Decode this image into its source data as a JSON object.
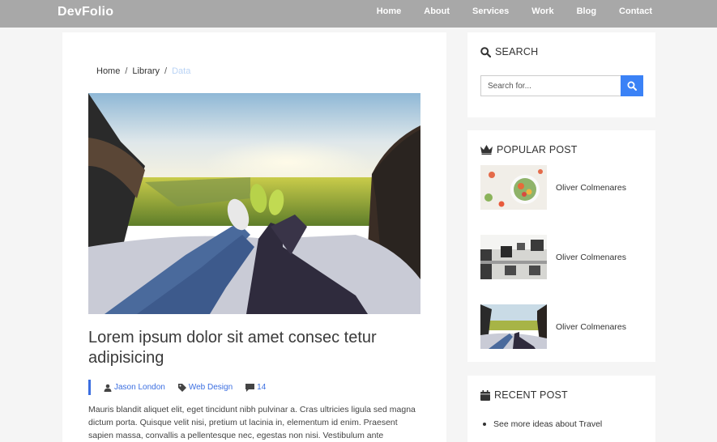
{
  "navbar": {
    "brand": "DevFolio",
    "links": [
      "Home",
      "About",
      "Services",
      "Work",
      "Blog",
      "Contact"
    ]
  },
  "breadcrumb": {
    "items": [
      "Home",
      "Library"
    ],
    "active": "Data"
  },
  "post": {
    "title": "Lorem ipsum dolor sit amet consec tetur adipisicing",
    "author": "Jason London",
    "category": "Web Design",
    "comments": "14",
    "body": "Mauris blandit aliquet elit, eget tincidunt nibh pulvinar a. Cras ultricies ligula sed magna dictum porta. Quisque velit nisi, pretium ut lacinia in, elementum id enim. Praesent sapien massa, convallis a pellentesque nec, egestas non nisi. Vestibulum ante"
  },
  "sidebar": {
    "search": {
      "title": "SEARCH",
      "placeholder": "Search for..."
    },
    "popular": {
      "title": "POPULAR POST",
      "items": [
        {
          "name": "Oliver Colmenares",
          "thumb": "salad-image"
        },
        {
          "name": "Oliver Colmenares",
          "thumb": "office-image"
        },
        {
          "name": "Oliver Colmenares",
          "thumb": "car-trunk-image"
        }
      ]
    },
    "recent": {
      "title": "RECENT POST",
      "items": [
        "See more ideas about Travel"
      ]
    }
  },
  "colors": {
    "navbar": "#a8a8a8",
    "accent": "#3b82f6",
    "meta": "#3b6ee0"
  }
}
